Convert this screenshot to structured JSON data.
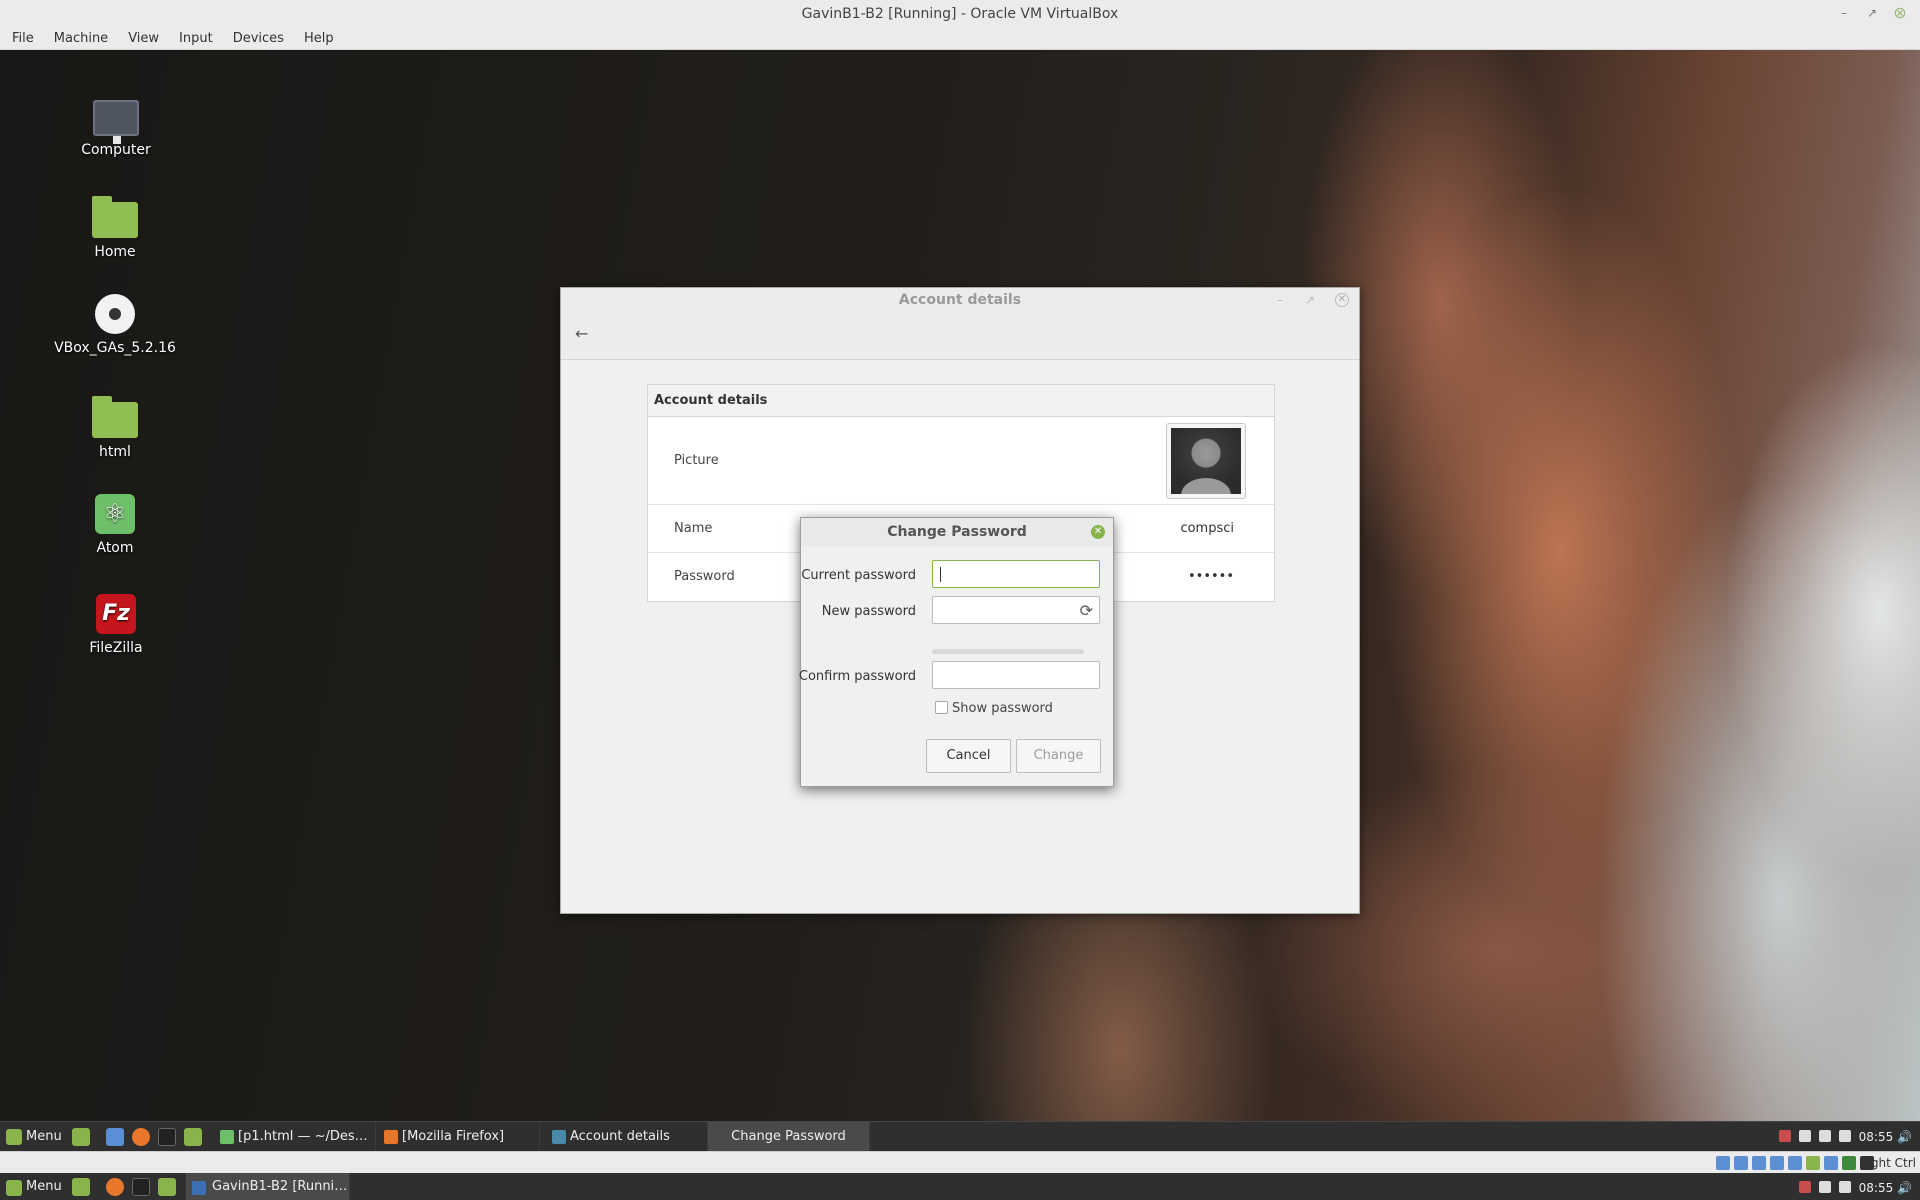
{
  "host": {
    "title": "GavinB1-B2 [Running] - Oracle VM VirtualBox",
    "menu": [
      "File",
      "Machine",
      "View",
      "Input",
      "Devices",
      "Help"
    ],
    "statusbar_hostkey": "Right Ctrl",
    "taskbar": {
      "menu_label": "Menu",
      "window_label": "GavinB1-B2 [Running...",
      "clock": "08:55"
    }
  },
  "desktop": {
    "icons": [
      {
        "label": "Computer",
        "icon": "monitor-icon"
      },
      {
        "label": "Home",
        "icon": "home-folder-icon"
      },
      {
        "label": "VBox_GAs_5.2.16",
        "icon": "disc-icon"
      },
      {
        "label": "html",
        "icon": "folder-link-icon"
      },
      {
        "label": "Atom",
        "icon": "atom-icon"
      },
      {
        "label": "FileZilla",
        "icon": "filezilla-icon"
      }
    ]
  },
  "account_window": {
    "title": "Account details",
    "panel_title": "Account details",
    "rows": {
      "picture_label": "Picture",
      "name_label": "Name",
      "name_value": "compsci",
      "password_label": "Password",
      "password_value": "••••••"
    }
  },
  "change_password_dialog": {
    "title": "Change Password",
    "current_password_label": "Current password",
    "current_password_value": "",
    "new_password_label": "New password",
    "new_password_value": "",
    "confirm_password_label": "Confirm password",
    "confirm_password_value": "",
    "show_password_label": "Show password",
    "show_password_checked": false,
    "cancel_label": "Cancel",
    "change_label": "Change"
  },
  "guest_taskbar": {
    "menu_label": "Menu",
    "windows": [
      {
        "label": "[p1.html — ~/Deskto...",
        "active": false
      },
      {
        "label": "[Mozilla Firefox]",
        "active": false
      },
      {
        "label": "Account details",
        "active": false
      },
      {
        "label": "Change Password",
        "active": true
      }
    ],
    "clock": "08:55"
  },
  "colors": {
    "accent": "#8ab34c",
    "taskbar": "#2f2f2f",
    "dialog_bg": "#f0f0f0"
  }
}
